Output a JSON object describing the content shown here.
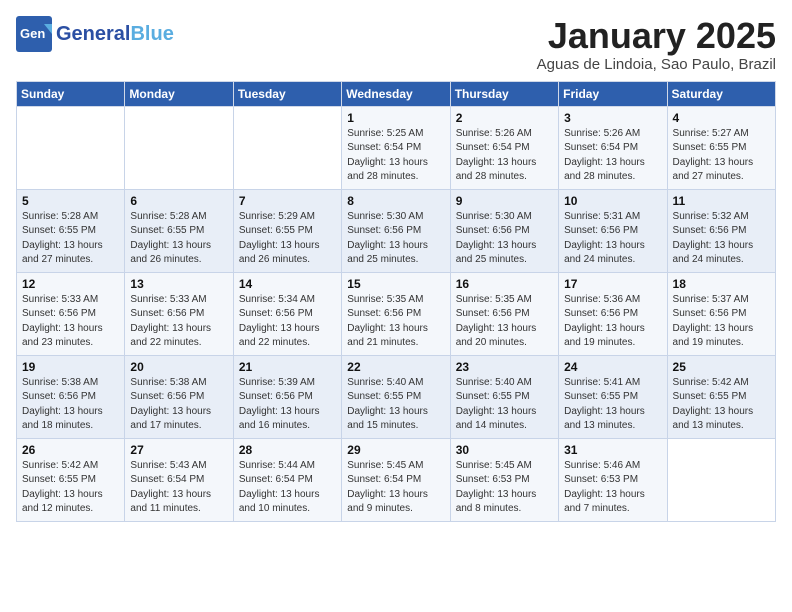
{
  "header": {
    "logo_line1": "General",
    "logo_line2": "Blue",
    "month": "January 2025",
    "location": "Aguas de Lindoia, Sao Paulo, Brazil"
  },
  "weekdays": [
    "Sunday",
    "Monday",
    "Tuesday",
    "Wednesday",
    "Thursday",
    "Friday",
    "Saturday"
  ],
  "weeks": [
    [
      {
        "day": "",
        "info": ""
      },
      {
        "day": "",
        "info": ""
      },
      {
        "day": "",
        "info": ""
      },
      {
        "day": "1",
        "info": "Sunrise: 5:25 AM\nSunset: 6:54 PM\nDaylight: 13 hours and 28 minutes."
      },
      {
        "day": "2",
        "info": "Sunrise: 5:26 AM\nSunset: 6:54 PM\nDaylight: 13 hours and 28 minutes."
      },
      {
        "day": "3",
        "info": "Sunrise: 5:26 AM\nSunset: 6:54 PM\nDaylight: 13 hours and 28 minutes."
      },
      {
        "day": "4",
        "info": "Sunrise: 5:27 AM\nSunset: 6:55 PM\nDaylight: 13 hours and 27 minutes."
      }
    ],
    [
      {
        "day": "5",
        "info": "Sunrise: 5:28 AM\nSunset: 6:55 PM\nDaylight: 13 hours and 27 minutes."
      },
      {
        "day": "6",
        "info": "Sunrise: 5:28 AM\nSunset: 6:55 PM\nDaylight: 13 hours and 26 minutes."
      },
      {
        "day": "7",
        "info": "Sunrise: 5:29 AM\nSunset: 6:55 PM\nDaylight: 13 hours and 26 minutes."
      },
      {
        "day": "8",
        "info": "Sunrise: 5:30 AM\nSunset: 6:56 PM\nDaylight: 13 hours and 25 minutes."
      },
      {
        "day": "9",
        "info": "Sunrise: 5:30 AM\nSunset: 6:56 PM\nDaylight: 13 hours and 25 minutes."
      },
      {
        "day": "10",
        "info": "Sunrise: 5:31 AM\nSunset: 6:56 PM\nDaylight: 13 hours and 24 minutes."
      },
      {
        "day": "11",
        "info": "Sunrise: 5:32 AM\nSunset: 6:56 PM\nDaylight: 13 hours and 24 minutes."
      }
    ],
    [
      {
        "day": "12",
        "info": "Sunrise: 5:33 AM\nSunset: 6:56 PM\nDaylight: 13 hours and 23 minutes."
      },
      {
        "day": "13",
        "info": "Sunrise: 5:33 AM\nSunset: 6:56 PM\nDaylight: 13 hours and 22 minutes."
      },
      {
        "day": "14",
        "info": "Sunrise: 5:34 AM\nSunset: 6:56 PM\nDaylight: 13 hours and 22 minutes."
      },
      {
        "day": "15",
        "info": "Sunrise: 5:35 AM\nSunset: 6:56 PM\nDaylight: 13 hours and 21 minutes."
      },
      {
        "day": "16",
        "info": "Sunrise: 5:35 AM\nSunset: 6:56 PM\nDaylight: 13 hours and 20 minutes."
      },
      {
        "day": "17",
        "info": "Sunrise: 5:36 AM\nSunset: 6:56 PM\nDaylight: 13 hours and 19 minutes."
      },
      {
        "day": "18",
        "info": "Sunrise: 5:37 AM\nSunset: 6:56 PM\nDaylight: 13 hours and 19 minutes."
      }
    ],
    [
      {
        "day": "19",
        "info": "Sunrise: 5:38 AM\nSunset: 6:56 PM\nDaylight: 13 hours and 18 minutes."
      },
      {
        "day": "20",
        "info": "Sunrise: 5:38 AM\nSunset: 6:56 PM\nDaylight: 13 hours and 17 minutes."
      },
      {
        "day": "21",
        "info": "Sunrise: 5:39 AM\nSunset: 6:56 PM\nDaylight: 13 hours and 16 minutes."
      },
      {
        "day": "22",
        "info": "Sunrise: 5:40 AM\nSunset: 6:55 PM\nDaylight: 13 hours and 15 minutes."
      },
      {
        "day": "23",
        "info": "Sunrise: 5:40 AM\nSunset: 6:55 PM\nDaylight: 13 hours and 14 minutes."
      },
      {
        "day": "24",
        "info": "Sunrise: 5:41 AM\nSunset: 6:55 PM\nDaylight: 13 hours and 13 minutes."
      },
      {
        "day": "25",
        "info": "Sunrise: 5:42 AM\nSunset: 6:55 PM\nDaylight: 13 hours and 13 minutes."
      }
    ],
    [
      {
        "day": "26",
        "info": "Sunrise: 5:42 AM\nSunset: 6:55 PM\nDaylight: 13 hours and 12 minutes."
      },
      {
        "day": "27",
        "info": "Sunrise: 5:43 AM\nSunset: 6:54 PM\nDaylight: 13 hours and 11 minutes."
      },
      {
        "day": "28",
        "info": "Sunrise: 5:44 AM\nSunset: 6:54 PM\nDaylight: 13 hours and 10 minutes."
      },
      {
        "day": "29",
        "info": "Sunrise: 5:45 AM\nSunset: 6:54 PM\nDaylight: 13 hours and 9 minutes."
      },
      {
        "day": "30",
        "info": "Sunrise: 5:45 AM\nSunset: 6:53 PM\nDaylight: 13 hours and 8 minutes."
      },
      {
        "day": "31",
        "info": "Sunrise: 5:46 AM\nSunset: 6:53 PM\nDaylight: 13 hours and 7 minutes."
      },
      {
        "day": "",
        "info": ""
      }
    ]
  ]
}
